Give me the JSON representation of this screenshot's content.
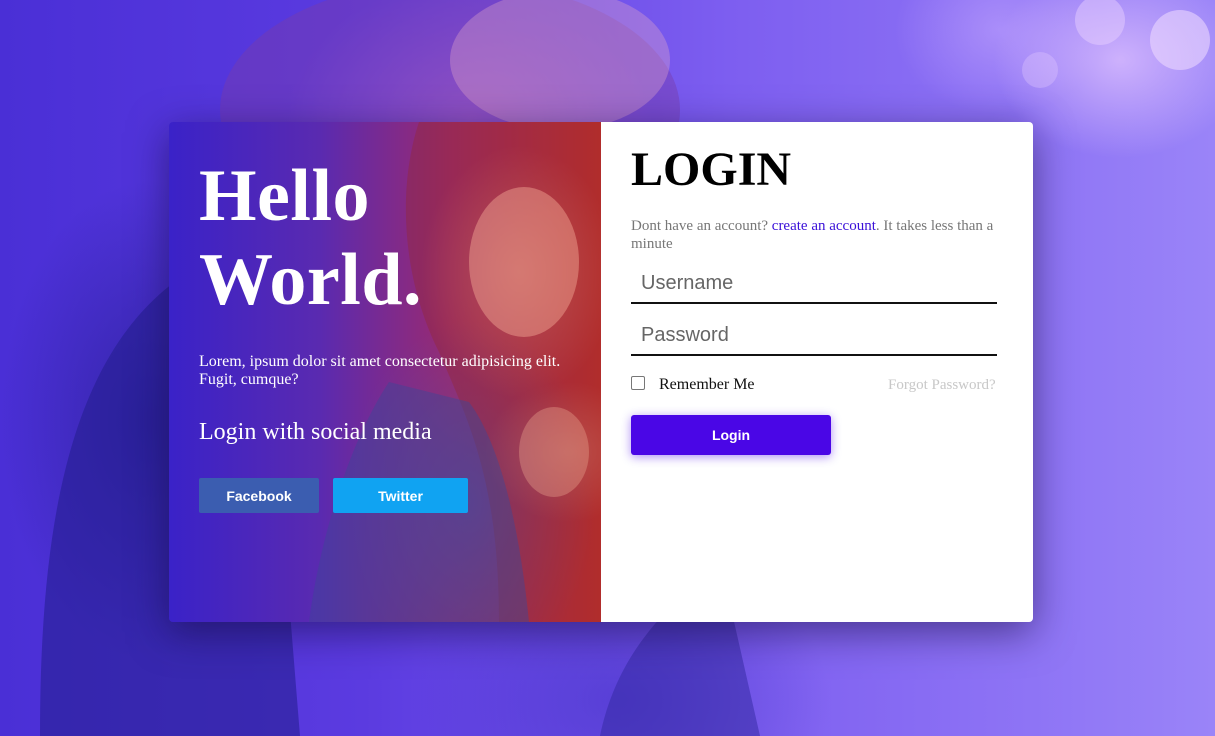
{
  "background": {
    "overlay_color": "#5b3be0"
  },
  "hero": {
    "title_line1": "Hello",
    "title_line2": "World.",
    "description": "Lorem, ipsum dolor sit amet consectetur adipisicing elit. Fugit, cumque?",
    "social_heading": "Login with social media",
    "facebook_label": "Facebook",
    "twitter_label": "Twitter",
    "facebook_color": "#3b5db0",
    "twitter_color": "#10a3f2"
  },
  "login": {
    "title": "LOGIN",
    "signup_prefix": "Dont have an account? ",
    "signup_link": "create an account",
    "signup_suffix": ". It takes less than a minute",
    "username_placeholder": "Username",
    "password_placeholder": "Password",
    "remember_label": "Remember Me",
    "remember_checked": false,
    "forgot_label": "Forgot Password?",
    "submit_label": "Login",
    "accent_color": "#4a06e6"
  }
}
